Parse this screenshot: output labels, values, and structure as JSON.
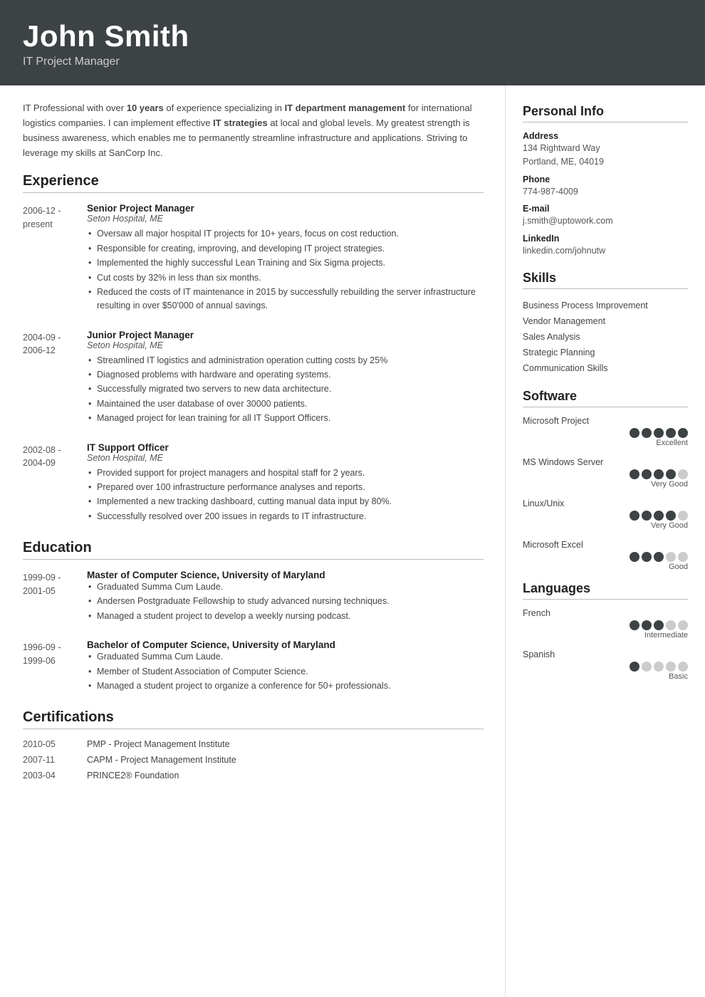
{
  "header": {
    "name": "John Smith",
    "title": "IT Project Manager"
  },
  "summary": {
    "text_parts": [
      "IT Professional with over ",
      "10 years",
      " of experience specializing in ",
      "IT department management",
      " for international logistics companies. I can implement effective ",
      "IT strategies",
      " at local and global levels. My greatest strength is business awareness, which enables me to permanently streamline infrastructure and applications. Striving to leverage my skills at SanCorp Inc."
    ]
  },
  "experience": {
    "section_label": "Experience",
    "entries": [
      {
        "date_start": "2006-12 -",
        "date_end": "present",
        "title": "Senior Project Manager",
        "company": "Seton Hospital, ME",
        "bullets": [
          "Oversaw all major hospital IT projects for 10+ years, focus on cost reduction.",
          "Responsible for creating, improving, and developing IT project strategies.",
          "Implemented the highly successful Lean Training and Six Sigma projects.",
          "Cut costs by 32% in less than six months.",
          "Reduced the costs of IT maintenance in 2015 by successfully rebuilding the server infrastructure resulting in over $50'000 of annual savings."
        ]
      },
      {
        "date_start": "2004-09 -",
        "date_end": "2006-12",
        "title": "Junior Project Manager",
        "company": "Seton Hospital, ME",
        "bullets": [
          "Streamlined IT logistics and administration operation cutting costs by 25%",
          "Diagnosed problems with hardware and operating systems.",
          "Successfully migrated two servers to new data architecture.",
          "Maintained the user database of over 30000 patients.",
          "Managed project for lean training for all IT Support Officers."
        ]
      },
      {
        "date_start": "2002-08 -",
        "date_end": "2004-09",
        "title": "IT Support Officer",
        "company": "Seton Hospital, ME",
        "bullets": [
          "Provided support for project managers and hospital staff for 2 years.",
          "Prepared over 100 infrastructure performance analyses and reports.",
          "Implemented a new tracking dashboard, cutting manual data input by 80%.",
          "Successfully resolved over 200 issues in regards to IT infrastructure."
        ]
      }
    ]
  },
  "education": {
    "section_label": "Education",
    "entries": [
      {
        "date_start": "1999-09 -",
        "date_end": "2001-05",
        "title": "Master of Computer Science, University of Maryland",
        "company": "",
        "bullets": [
          "Graduated Summa Cum Laude.",
          "Andersen Postgraduate Fellowship to study advanced nursing techniques.",
          "Managed a student project to develop a weekly nursing podcast."
        ]
      },
      {
        "date_start": "1996-09 -",
        "date_end": "1999-06",
        "title": "Bachelor of Computer Science, University of Maryland",
        "company": "",
        "bullets": [
          "Graduated Summa Cum Laude.",
          "Member of Student Association of Computer Science.",
          "Managed a student project to organize a conference for 50+ professionals."
        ]
      }
    ]
  },
  "certifications": {
    "section_label": "Certifications",
    "entries": [
      {
        "date": "2010-05",
        "name": "PMP - Project Management Institute"
      },
      {
        "date": "2007-11",
        "name": "CAPM - Project Management Institute"
      },
      {
        "date": "2003-04",
        "name": "PRINCE2® Foundation"
      }
    ]
  },
  "personal_info": {
    "section_label": "Personal Info",
    "fields": [
      {
        "label": "Address",
        "value": "134 Rightward Way\nPortland, ME, 04019"
      },
      {
        "label": "Phone",
        "value": "774-987-4009"
      },
      {
        "label": "E-mail",
        "value": "j.smith@uptowork.com"
      },
      {
        "label": "LinkedIn",
        "value": "linkedin.com/johnutw"
      }
    ]
  },
  "skills": {
    "section_label": "Skills",
    "items": [
      "Business Process Improvement",
      "Vendor Management",
      "Sales Analysis",
      "Strategic Planning",
      "Communication Skills"
    ]
  },
  "software": {
    "section_label": "Software",
    "items": [
      {
        "name": "Microsoft Project",
        "filled": 5,
        "total": 5,
        "label": "Excellent"
      },
      {
        "name": "MS Windows Server",
        "filled": 4,
        "total": 5,
        "label": "Very Good"
      },
      {
        "name": "Linux/Unix",
        "filled": 4,
        "total": 5,
        "label": "Very Good"
      },
      {
        "name": "Microsoft Excel",
        "filled": 3,
        "total": 5,
        "label": "Good"
      }
    ]
  },
  "languages": {
    "section_label": "Languages",
    "items": [
      {
        "name": "French",
        "filled": 3,
        "total": 5,
        "label": "Intermediate"
      },
      {
        "name": "Spanish",
        "filled": 1,
        "total": 5,
        "label": "Basic"
      }
    ]
  }
}
